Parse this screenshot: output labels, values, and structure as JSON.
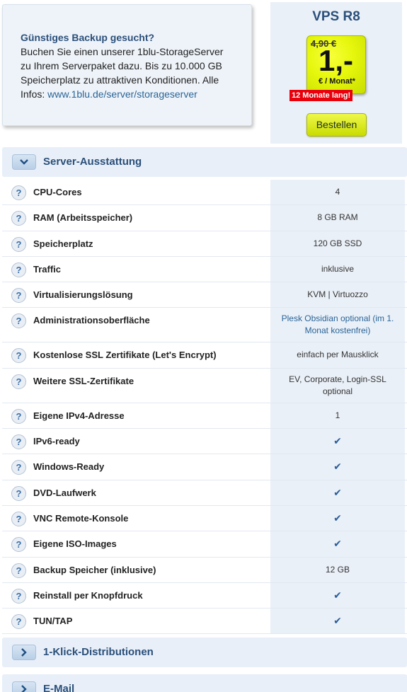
{
  "promo": {
    "title": "Günstiges Backup gesucht?",
    "line1": "Buchen Sie einen unserer 1blu-StorageServer",
    "line2": "zu Ihrem Serverpaket dazu. Bis zu 10.000 GB",
    "line3": "Speicherplatz zu attraktiven Konditionen. Alle",
    "line4_prefix": "Infos: ",
    "link": "www.1blu.de/server/storageserver"
  },
  "product": {
    "name": "VPS R8",
    "old_price": "4,90 €",
    "price": "1,-",
    "per_month": "€ / Monat*",
    "badge": "12 Monate lang!",
    "order_button": "Bestellen"
  },
  "sections": {
    "server": {
      "title": "Server-Ausstattung",
      "toggle_icon": "chevron-down"
    },
    "distros": {
      "title": "1-Klick-Distributionen",
      "toggle_icon": "chevron-right"
    },
    "email": {
      "title": "E-Mail",
      "toggle_icon": "chevron-right"
    }
  },
  "help_icon": "?",
  "check_icon": "✔",
  "features": [
    {
      "label": "CPU-Cores",
      "value": "4"
    },
    {
      "label": "RAM (Arbeitsspeicher)",
      "value": "8 GB RAM"
    },
    {
      "label": "Speicherplatz",
      "value": "120 GB SSD"
    },
    {
      "label": "Traffic",
      "value": "inklusive"
    },
    {
      "label": "Virtualisierungslösung",
      "value": "KVM | Virtuozzo"
    },
    {
      "label": "Administrationsoberfläche",
      "value_line1": "Plesk Obsidian optional (im 1.",
      "value_line2": "Monat kostenfrei)"
    },
    {
      "label": "Kostenlose SSL Zertifikate (Let's Encrypt)",
      "value": "einfach per Mausklick"
    },
    {
      "label": "Weitere SSL-Zertifikate",
      "value_line1": "EV, Corporate, Login-SSL",
      "value_line2": "optional"
    },
    {
      "label": "Eigene IPv4-Adresse",
      "value": "1"
    },
    {
      "label": "IPv6-ready",
      "check": true
    },
    {
      "label": "Windows-Ready",
      "check": true
    },
    {
      "label": "DVD-Laufwerk",
      "check": true
    },
    {
      "label": "VNC Remote-Konsole",
      "check": true
    },
    {
      "label": "Eigene ISO-Images",
      "check": true
    },
    {
      "label": "Backup Speicher (inklusive)",
      "value": "12 GB"
    },
    {
      "label": "Reinstall per Knopfdruck",
      "check": true
    },
    {
      "label": "TUN/TAP",
      "check": true
    }
  ]
}
